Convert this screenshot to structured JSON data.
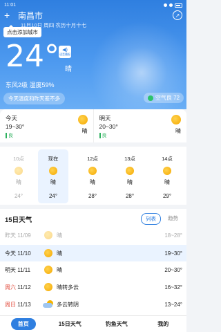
{
  "status_bar": {
    "time": "11:01"
  },
  "header": {
    "city": "南昌市",
    "date_line": "11月10日 周四 农历十月十七",
    "add_city_tip": "点击添加城市"
  },
  "current": {
    "temperature": "24°",
    "condition": "晴",
    "voice_label": "语音播报",
    "wind_humidity": "东风2级 湿度59%",
    "compare_tip": "今天温度和昨天差不多",
    "aqi": "空气良 72"
  },
  "two_day": [
    {
      "name": "今天",
      "range": "19~30°",
      "aqi": "良",
      "condition": "晴"
    },
    {
      "name": "明天",
      "range": "20~30°",
      "aqi": "良",
      "condition": "晴"
    }
  ],
  "hourly": [
    {
      "time": "10点",
      "condition": "晴",
      "temp": "24°",
      "state": "past"
    },
    {
      "time": "现在",
      "condition": "晴",
      "temp": "24°",
      "state": "current"
    },
    {
      "time": "12点",
      "condition": "晴",
      "temp": "28°",
      "state": "future"
    },
    {
      "time": "13点",
      "condition": "晴",
      "temp": "28°",
      "state": "future"
    },
    {
      "time": "14点",
      "condition": "晴",
      "temp": "29°",
      "state": "future"
    }
  ],
  "fifteen_day": {
    "title": "15日天气",
    "toggle": {
      "list": "列表",
      "trend": "趋势",
      "active": "list"
    },
    "rows": [
      {
        "label": "昨天",
        "date": "11/09",
        "condition": "晴",
        "range": "18~28°",
        "icon": "sun-icon",
        "kind": "yest"
      },
      {
        "label": "今天",
        "date": "11/10",
        "condition": "晴",
        "range": "19~30°",
        "icon": "sun-icon",
        "kind": "today"
      },
      {
        "label": "明天",
        "date": "11/11",
        "condition": "晴",
        "range": "20~30°",
        "icon": "sun-icon",
        "kind": "normal"
      },
      {
        "label": "周六",
        "date": "11/12",
        "condition": "晴转多云",
        "range": "16~32°",
        "icon": "sun-icon",
        "kind": "weekend"
      },
      {
        "label": "周日",
        "date": "11/13",
        "condition": "多云转阴",
        "range": "13~24°",
        "icon": "partly-cloudy-icon",
        "kind": "weekend"
      }
    ]
  },
  "tabbar": [
    {
      "label": "首页",
      "active": true
    },
    {
      "label": "15日天气",
      "active": false
    },
    {
      "label": "钓鱼天气",
      "active": false
    },
    {
      "label": "我的",
      "active": false
    }
  ],
  "colors": {
    "primary": "#2f7fe0",
    "good_air": "#2cb15e",
    "weekend": "#e24a3b"
  }
}
